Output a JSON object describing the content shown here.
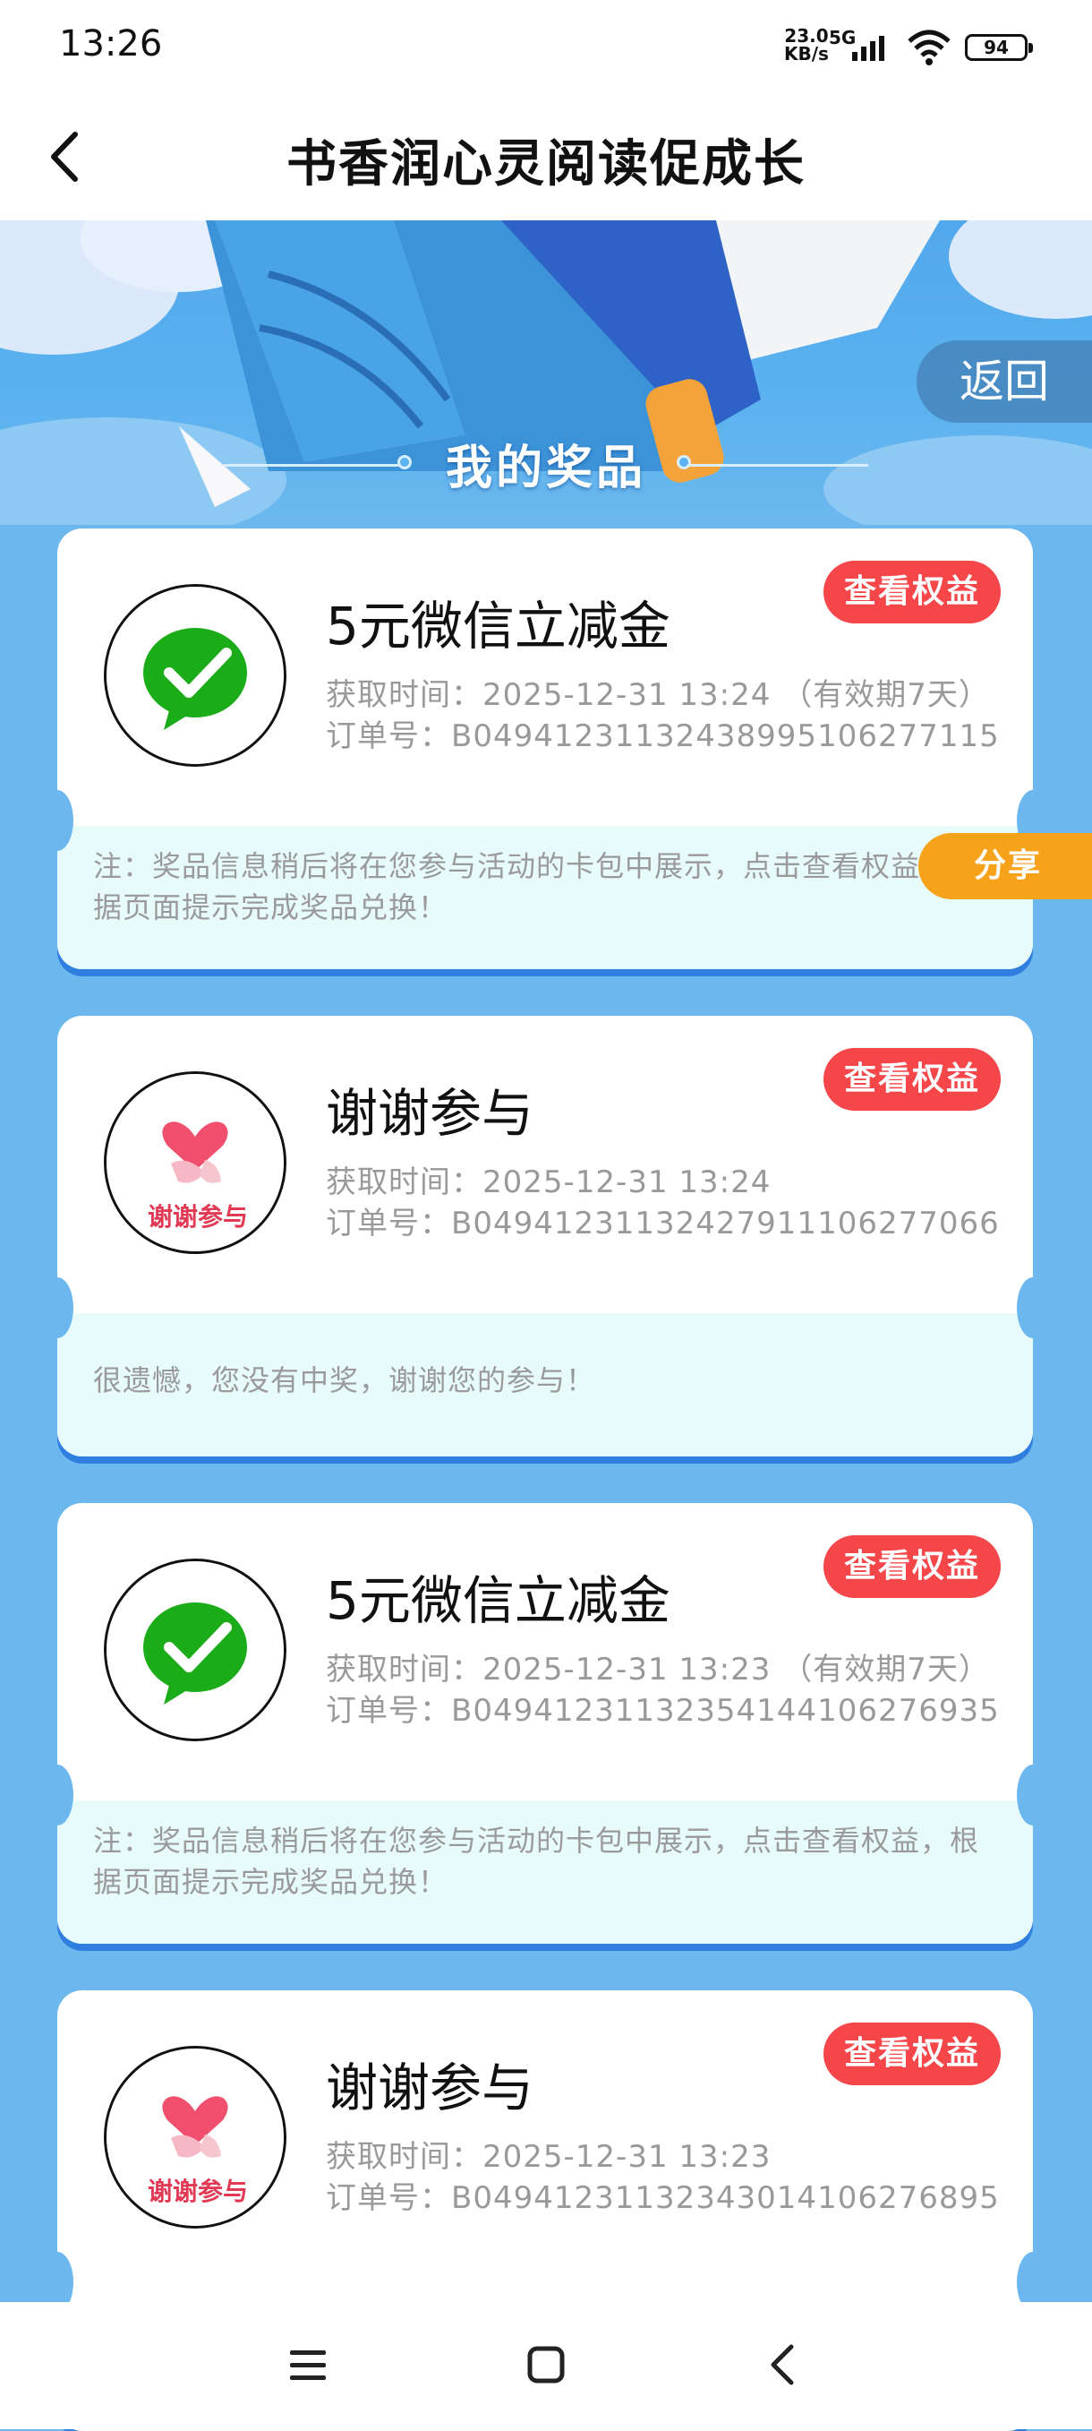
{
  "status": {
    "time": "13:26",
    "speed": "23.0",
    "speed_unit": "KB/s",
    "network": "5G",
    "battery": "94"
  },
  "header": {
    "title": "书香润心灵阅读促成长"
  },
  "banner": {
    "return_label": "返回",
    "section_title": "我的奖品"
  },
  "share_label": "分享",
  "colors": {
    "accent_red": "#f5464a",
    "share_orange": "#f7a21b",
    "page_blue": "#6cb8ee",
    "wechat_green": "#1aad19"
  },
  "cards": [
    {
      "icon": "wechat-icon",
      "name": "5元微信立减金",
      "time": "获取时间：2025-12-31 13:24 （有效期7天）",
      "order": "订单号：B049412311324389951062771​15",
      "button": "查看权益",
      "note": "注：奖品信息稍后将在您参与活动的卡包中展示，点击查看权益，根据页面提示完成奖品兑换！"
    },
    {
      "icon": "thanks-icon",
      "icon_text": "谢谢参与",
      "name": "谢谢参与",
      "time": "获取时间：2025-12-31 13:24",
      "order": "订单号：B049412311324279111062770​66",
      "button": "查看权益",
      "note": "很遗憾，您没有中奖，谢谢您的参与！"
    },
    {
      "icon": "wechat-icon",
      "name": "5元微信立减金",
      "time": "获取时间：2025-12-31 13:23 （有效期7天）",
      "order": "订单号：B049412311323541441062769​35",
      "button": "查看权益",
      "note": "注：奖品信息稍后将在您参与活动的卡包中展示，点击查看权益，根据页面提示完成奖品兑换！"
    },
    {
      "icon": "thanks-icon",
      "icon_text": "谢谢参与",
      "name": "谢谢参与",
      "time": "获取时间：2025-12-31 13:23",
      "order": "订单号：B049412311323430141062768​95",
      "button": "查看权益",
      "note": ""
    }
  ]
}
